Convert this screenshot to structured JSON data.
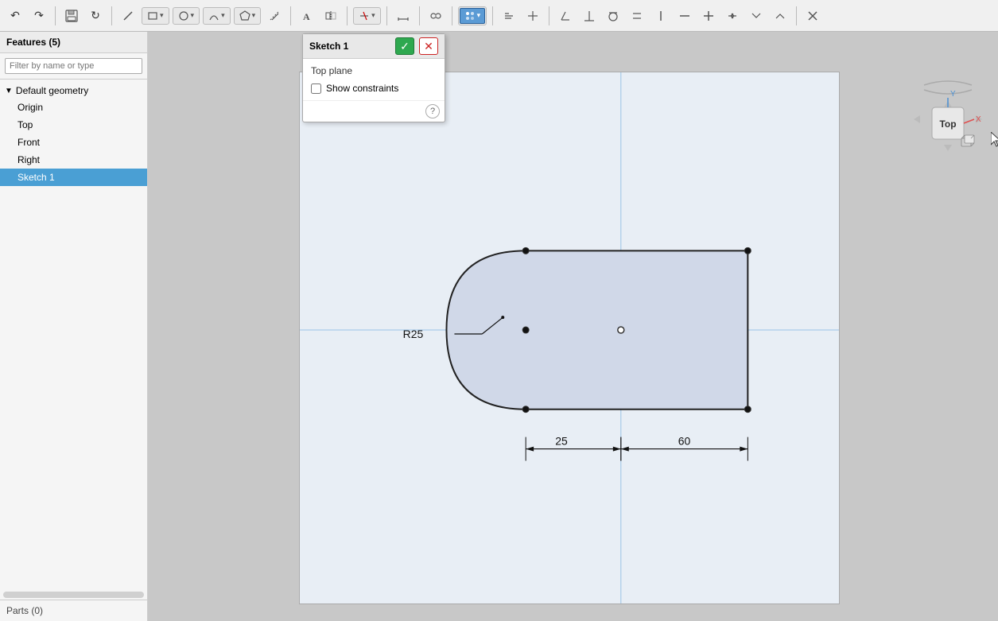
{
  "toolbar": {
    "label": "Circular Pattern",
    "icons": [
      "undo",
      "redo",
      "sep",
      "save",
      "refresh",
      "sep",
      "line",
      "rectangle",
      "circle",
      "arc",
      "polygon",
      "offset",
      "sep",
      "text",
      "mirror",
      "sep",
      "trim",
      "extend",
      "sep",
      "dimension",
      "sep",
      "constraint",
      "sep",
      "pattern",
      "sep",
      "sketch-tools",
      "sep",
      "import",
      "sep",
      "view1",
      "view2",
      "view3",
      "view4",
      "view5",
      "view6",
      "view7",
      "view8",
      "view9",
      "view10"
    ]
  },
  "sidebar": {
    "header": "Features (5)",
    "search_placeholder": "Filter by name or type",
    "tree": {
      "group_label": "Default geometry",
      "items": [
        "Origin",
        "Top",
        "Front",
        "Right",
        "Sketch 1"
      ]
    },
    "bottom_label": "Parts (0)"
  },
  "sketch_panel": {
    "title": "Sketch 1",
    "confirm_label": "✓",
    "cancel_label": "✕",
    "plane_label": "Top plane",
    "show_constraints_label": "Show constraints",
    "help_label": "?"
  },
  "drawing": {
    "r_label": "R25",
    "dim1_label": "25",
    "dim2_label": "60"
  },
  "viewcube": {
    "top_label": "Top",
    "x_label": "X",
    "y_label": "Y"
  }
}
